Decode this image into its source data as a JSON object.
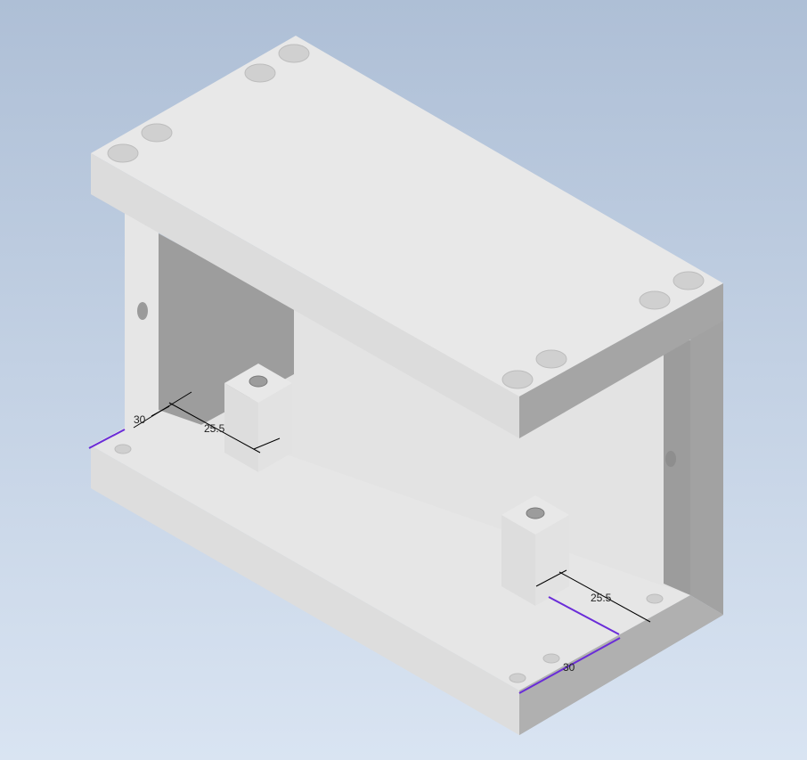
{
  "scene": {
    "background_top": "#aebfd6",
    "background_bottom": "#d8e3f1",
    "colors": {
      "face_light": "#e8e8e8",
      "face_mid": "#dedede",
      "face_dark": "#a0a0a0",
      "face_shadow": "#909090",
      "hole": "#cfcfcf",
      "dimension_line": "#000000",
      "accent_line": "#6a2cd8"
    }
  },
  "dimensions": {
    "left_depth": "30",
    "left_offset": "25.5",
    "right_offset": "25.5",
    "right_depth": "30"
  }
}
